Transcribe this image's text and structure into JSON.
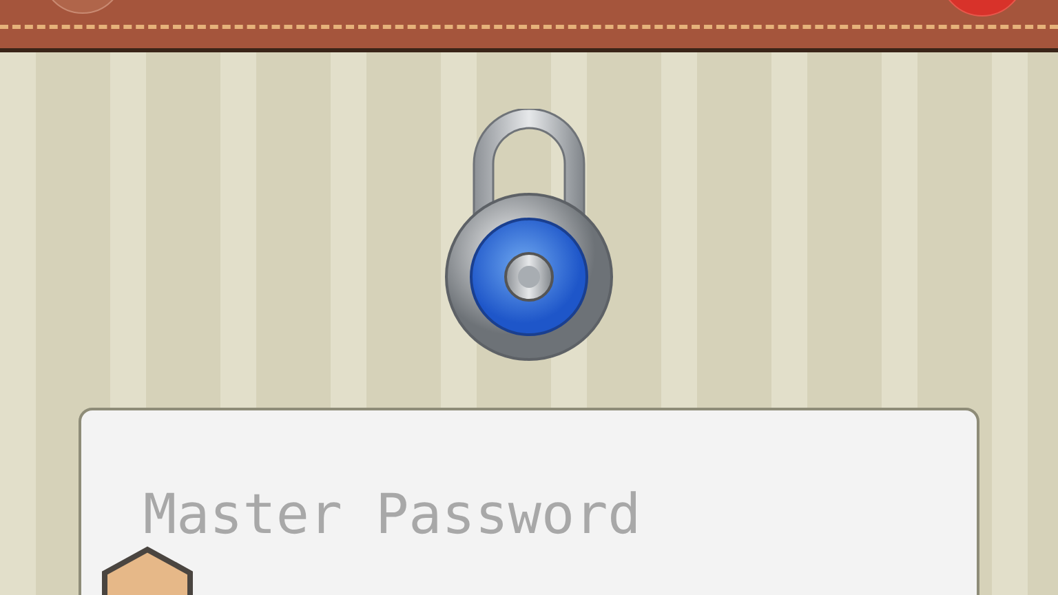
{
  "password_field": {
    "placeholder": "Master Password"
  }
}
